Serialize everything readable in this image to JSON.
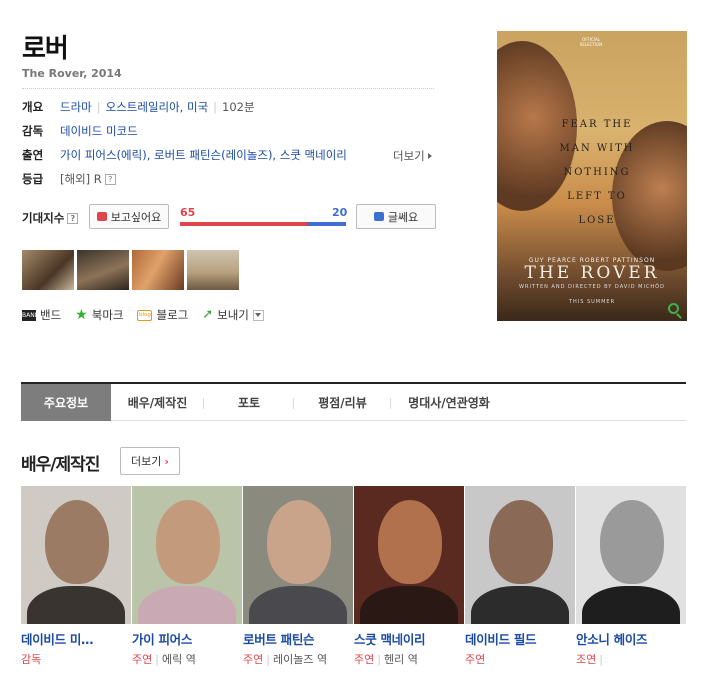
{
  "movie": {
    "title": "로버",
    "subtitle": "The Rover, 2014"
  },
  "info": {
    "overview_label": "개요",
    "genre": "드라마",
    "country": "오스트레일리아, 미국",
    "runtime": "102분",
    "director_label": "감독",
    "director": "데이비드 미코드",
    "cast_label": "출연",
    "cast_text": "가이 피어스(에릭), 로버트 패틴슨(레이놀즈), 스쿳 맥네이리",
    "cast_more": "더보기",
    "rating_label": "등급",
    "rating": "[해외] R",
    "help_mark": "?"
  },
  "expectation": {
    "label": "기대지수",
    "want_label": "보고싶어요",
    "meh_label": "글쎄요",
    "want_count": "65",
    "meh_count": "20",
    "want_fraction": 0.765
  },
  "share": {
    "band_icon_text": "BAND",
    "band": "밴드",
    "bookmark": "북마크",
    "blog_icon_text": "blog",
    "blog": "블로그",
    "send": "보내기"
  },
  "poster": {
    "tagline": "FEAR THE MAN WITH NOTHING LEFT TO LOSE",
    "seal": "OFFICIAL SELECTION",
    "names": "GUY PEARCE   ROBERT PATTINSON",
    "title": "THE ROVER",
    "credit": "WRITTEN AND DIRECTED BY DAVID MICHÔD",
    "release": "THIS SUMMER"
  },
  "tabs": [
    {
      "label": "주요정보"
    },
    {
      "label": "배우/제작진"
    },
    {
      "label": "포토"
    },
    {
      "label": "평점/리뷰"
    },
    {
      "label": "명대사/연관영화"
    }
  ],
  "cast_section": {
    "title": "배우/제작진",
    "more": "더보기",
    "chevron": "›",
    "people": [
      {
        "name": "데이비드 미…",
        "role": "감독",
        "character": ""
      },
      {
        "name": "가이 피어스",
        "role": "주연",
        "character": "에릭 역"
      },
      {
        "name": "로버트 패틴슨",
        "role": "주연",
        "character": "레이놀즈 역"
      },
      {
        "name": "스쿳 맥네이리",
        "role": "주연",
        "character": "헨리 역"
      },
      {
        "name": "데이비드 필드",
        "role": "주연",
        "character": ""
      },
      {
        "name": "안소니 헤이즈",
        "role": "조연",
        "character": ""
      }
    ]
  },
  "colors": {
    "link": "#1b4aa3",
    "want": "#e0454b",
    "meh": "#3d6fd2",
    "tab_active": "#7d7d7d"
  }
}
